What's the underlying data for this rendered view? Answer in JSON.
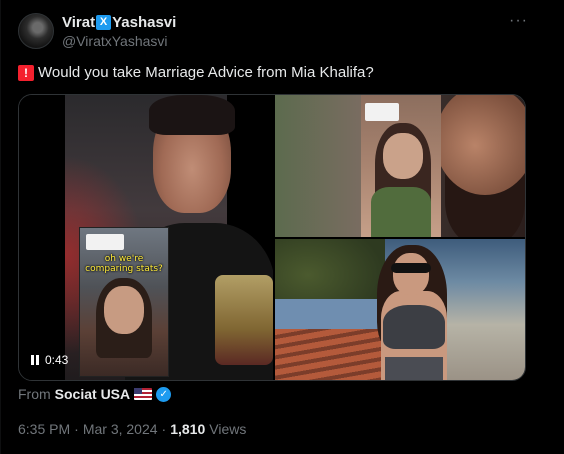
{
  "author": {
    "name_part1": "Virat",
    "name_badge": "X",
    "name_part2": "Yashasvi",
    "handle": "@ViratxYashasvi"
  },
  "menu_label": "···",
  "tweet": {
    "emoji": "🚨",
    "text": "Would you take Marriage Advice from Mia Khalifa?"
  },
  "video": {
    "caption": "oh we're comparing stats?",
    "time": "0:43"
  },
  "source": {
    "prefix": "From",
    "name": "Sociat USA",
    "verified_icon": "✓"
  },
  "meta": {
    "time": "6:35 PM",
    "separator": "·",
    "date": "Mar 3, 2024",
    "views_count": "1,810",
    "views_label": "Views"
  },
  "colors": {
    "background": "#000000",
    "text_primary": "#e7e9ea",
    "text_secondary": "#71767b",
    "accent": "#1d9bf0"
  }
}
